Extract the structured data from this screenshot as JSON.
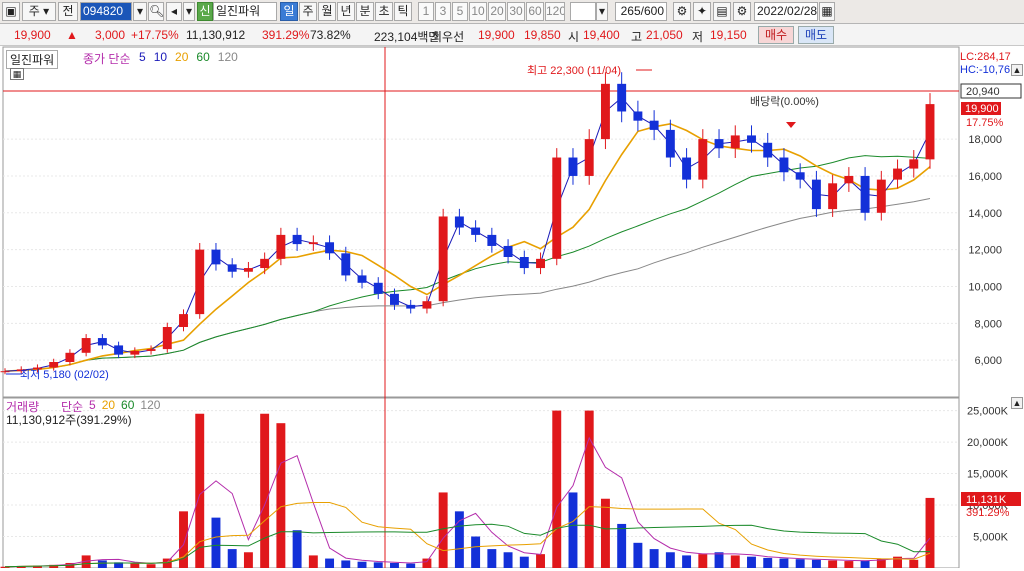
{
  "toolbar": {
    "market": "주",
    "type": "전",
    "code": "094820",
    "new_badge": "신",
    "name": "일진파워",
    "periods": [
      "일",
      "주",
      "월",
      "년",
      "분",
      "초",
      "틱"
    ],
    "active_period": "일",
    "ticks": [
      "1",
      "3",
      "5",
      "10",
      "20",
      "30",
      "60",
      "120"
    ],
    "count": "265",
    "count_max": "/600",
    "date": "2022/02/28"
  },
  "quote": {
    "price": "19,900",
    "change": "3,000",
    "change_pct": "+17.75%",
    "volume": "11,130,912",
    "volume_ratio": "391.29%",
    "rate": "73.82%",
    "amount": "223,104백만",
    "best_ask_label": "최우선",
    "best_ask": "19,900",
    "best_bid": "19,850",
    "open_label": "시",
    "open": "19,400",
    "high_label": "고",
    "high": "21,050",
    "low_label": "저",
    "low": "19,150",
    "buy": "매수",
    "sell": "매도"
  },
  "price_panel": {
    "tab": "일진파워",
    "legend_prefix": "종가 단순",
    "ma_periods": [
      "5",
      "10",
      "20",
      "60",
      "120"
    ],
    "ma_colors": [
      "#1a1ab8",
      "#1a1ab8",
      "#e8a000",
      "#1a8a2a",
      "#888888"
    ],
    "lc": "LC:284,17",
    "hc": "HC:-10,76",
    "high_label": "최고 22,300 (11/04)",
    "low_label": "최저 5,180 (02/02)",
    "dividend_label": "배당락(0.00%)",
    "marker_high": "20,940",
    "marker_last": "19,900",
    "marker_pct": "17.75%"
  },
  "volume_panel": {
    "legend_prefix": "거래량",
    "legend_ma": "단순",
    "ma_periods": [
      "5",
      "20",
      "60",
      "120"
    ],
    "value_text": "11,130,912주(391.29%)",
    "marker_vol": "11,131K",
    "marker_pct": "391.29%"
  },
  "chart_data": [
    {
      "type": "candlestick",
      "title": "일진파워",
      "x_range": [
        "2021-02",
        "2022-02-28"
      ],
      "ylim": [
        4000,
        23000
      ],
      "y_ticks": [
        "6,000",
        "8,000",
        "10,000",
        "12,000",
        "14,000",
        "16,000",
        "18,000"
      ],
      "series": [
        {
          "name": "종가",
          "close": [
            5400,
            5500,
            5600,
            5900,
            6400,
            7200,
            6800,
            6300,
            6500,
            6600,
            7800,
            8500,
            12000,
            11200,
            10800,
            11000,
            11500,
            12800,
            12300,
            12400,
            11800,
            10600,
            10200,
            9600,
            9000,
            8800,
            9200,
            13800,
            13200,
            12800,
            12200,
            11600,
            11000,
            11500,
            17000,
            16000,
            18000,
            21000,
            19500,
            19000,
            18500,
            17000,
            15800,
            18000,
            17500,
            18200,
            17800,
            17000,
            16200,
            15800,
            14200,
            15600,
            16000,
            14000,
            15800,
            16400,
            16900,
            19900
          ]
        }
      ]
    },
    {
      "type": "bar",
      "title": "거래량",
      "ylim": [
        0,
        27000
      ],
      "y_ticks": [
        "5,000K",
        "10,000K",
        "15,000K",
        "20,000K",
        "25,000K"
      ],
      "series": [
        {
          "name": "거래량",
          "values": [
            200,
            300,
            400,
            500,
            800,
            2000,
            1200,
            900,
            700,
            600,
            1500,
            9000,
            24500,
            8000,
            3000,
            2500,
            24500,
            23000,
            6000,
            2000,
            1500,
            1200,
            1000,
            900,
            800,
            700,
            1500,
            12000,
            9000,
            5000,
            3000,
            2500,
            1800,
            2200,
            25000,
            12000,
            25000,
            11000,
            7000,
            4000,
            3000,
            2500,
            2000,
            2200,
            2500,
            2000,
            1800,
            1600,
            1500,
            1400,
            1300,
            1200,
            1100,
            1200,
            1500,
            1800,
            1300,
            11131
          ]
        }
      ]
    }
  ]
}
